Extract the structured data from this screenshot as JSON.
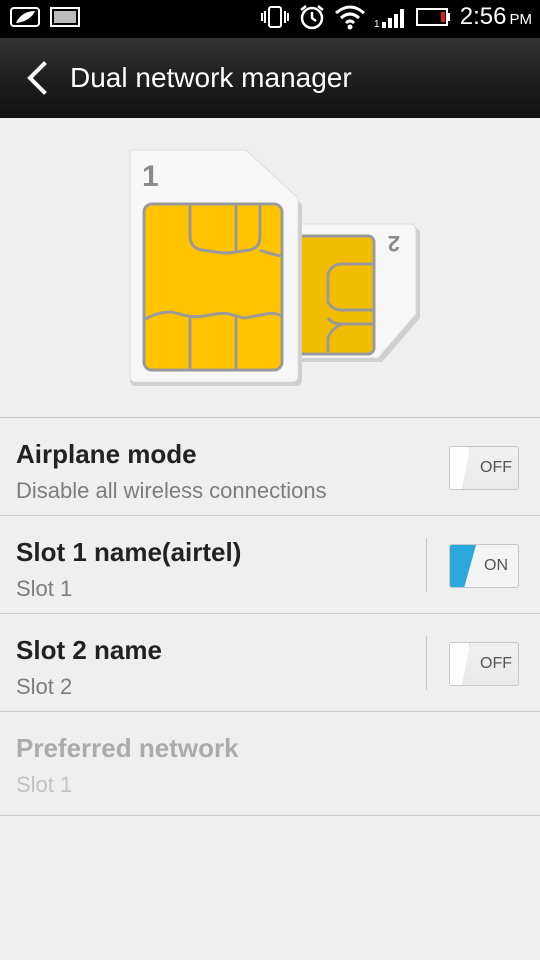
{
  "status_bar": {
    "time": "2:56",
    "ampm": "PM",
    "icons": [
      "leaf-icon",
      "image-icon",
      "vibrate-icon",
      "alarm-icon",
      "wifi-icon",
      "signal-icon",
      "battery-icon"
    ]
  },
  "header": {
    "title": "Dual network manager",
    "back_icon": "back-arrow-icon"
  },
  "illustration": {
    "sim1_number": "1",
    "sim2_number": "2",
    "chip_color": "#ffc300",
    "card_color": "#f7f7f7"
  },
  "settings": [
    {
      "title": "Airplane mode",
      "subtitle": "Disable all wireless connections",
      "toggle": "OFF",
      "enabled": true
    },
    {
      "title": "Slot 1 name(airtel)",
      "subtitle": "Slot 1",
      "toggle": "ON",
      "enabled": true
    },
    {
      "title": "Slot 2 name",
      "subtitle": "Slot 2",
      "toggle": "OFF",
      "enabled": true
    },
    {
      "title": "Preferred network",
      "subtitle": "Slot 1",
      "enabled": false
    }
  ],
  "colors": {
    "accent_on": "#2aa7dc",
    "background": "#efefef",
    "title_bar": "#1c1c1c"
  }
}
